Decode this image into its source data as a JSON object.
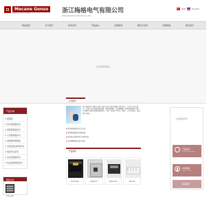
{
  "header": {
    "brand_text": "Mecane Gonso",
    "brand_sub": "MANGIN ELECTRICAL",
    "company_cn": "浙江梅格电气有限公司",
    "company_en": "ZHEJIANG MEIGE ELECTRIC CO.,LTD",
    "lang_cn": "中文",
    "lang_en": "English"
  },
  "nav": {
    "items": [
      "网站首页",
      "关于我们",
      "新闻资讯",
      "产品中心",
      "资质荣誉",
      "服务与支持",
      "营销网络",
      "联系我们"
    ]
  },
  "banner": {
    "hint": "无此数据或图片"
  },
  "left": {
    "title": "产品分类",
    "items": [
      "断路器",
      "塑壳断路器系列",
      "微型断路器系列",
      "小型断路器系列",
      "漏电保护断路器",
      "双电源自动转换开关",
      "隔离开关系列",
      "交流接触器系列",
      "热过载继电器系列"
    ],
    "contact_title": "联系方式",
    "qr_label": "扫描二维码"
  },
  "center": {
    "intro_tab": "公司简介",
    "intro_text": "浙江梅格电气有限公司是一家专业生产低压电器产品的企业。公司位于浙江温州，主要产品包括塑壳断路器、微型断路器、交流接触器、双电源转换开关等。公司拥有完善的质量管理体系，产品广泛应用于电力、建筑、工业等领域，深受客户信赖。",
    "links": [
      "塑壳断路器系列产品介绍",
      "微型断路器常见问题处理",
      "双电源自动转换开关选型指南",
      "交流接触器的安装与维护"
    ],
    "products_tab": "产品展示",
    "products": [
      "MC1N-100",
      "MGSE-63",
      "MGDA-125",
      "MG5-63"
    ]
  },
  "right": {
    "hint": "无此数据或图片",
    "box1_title": "产品目录",
    "box1_sub": "PDF File Download",
    "box2_title": "在线客服",
    "box2_sub": "online service",
    "box3_title": "联系我们"
  }
}
